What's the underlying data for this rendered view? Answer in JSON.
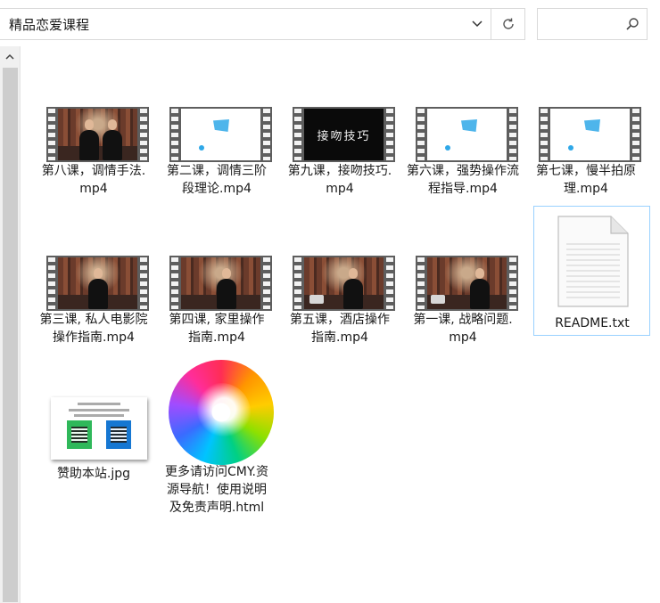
{
  "address_bar": {
    "path": "精品恋爱课程"
  },
  "search": {
    "placeholder": ""
  },
  "files": [
    {
      "name": "第八课，调情手法.mp4",
      "type": "video",
      "thumb": "scene-two"
    },
    {
      "name": "第二课，调情三阶段理论.mp4",
      "type": "video",
      "thumb": "white"
    },
    {
      "name": "第九课，接吻技巧.mp4",
      "type": "video",
      "thumb": "black",
      "thumb_text": "接吻技巧"
    },
    {
      "name": "第六课，强势操作流程指导.mp4",
      "type": "video",
      "thumb": "white"
    },
    {
      "name": "第七课，慢半拍原理.mp4",
      "type": "video",
      "thumb": "white"
    },
    {
      "name": "第三课, 私人电影院操作指南.mp4",
      "type": "video",
      "thumb": "scene-one"
    },
    {
      "name": "第四课, 家里操作指南.mp4",
      "type": "video",
      "thumb": "scene-one"
    },
    {
      "name": "第五课，酒店操作指南.mp4",
      "type": "video",
      "thumb": "scene-one"
    },
    {
      "name": "第一课, 战略问题.mp4",
      "type": "video",
      "thumb": "scene-one"
    },
    {
      "name": "README.txt",
      "type": "text",
      "selected": true
    },
    {
      "name": "赞助本站.jpg",
      "type": "image"
    },
    {
      "name": "更多请访问CMY.资源导航！使用说明及免责声明.html",
      "type": "html"
    }
  ],
  "colors": {
    "selection_border": "#99d1ff",
    "film_strip": "#5e5e5e",
    "accent_blue": "#2fa8e8"
  },
  "icons": {
    "address_dropdown": "chevron-down-icon",
    "refresh": "refresh-icon",
    "search": "search-icon",
    "scroll_up": "chevron-up-icon"
  }
}
